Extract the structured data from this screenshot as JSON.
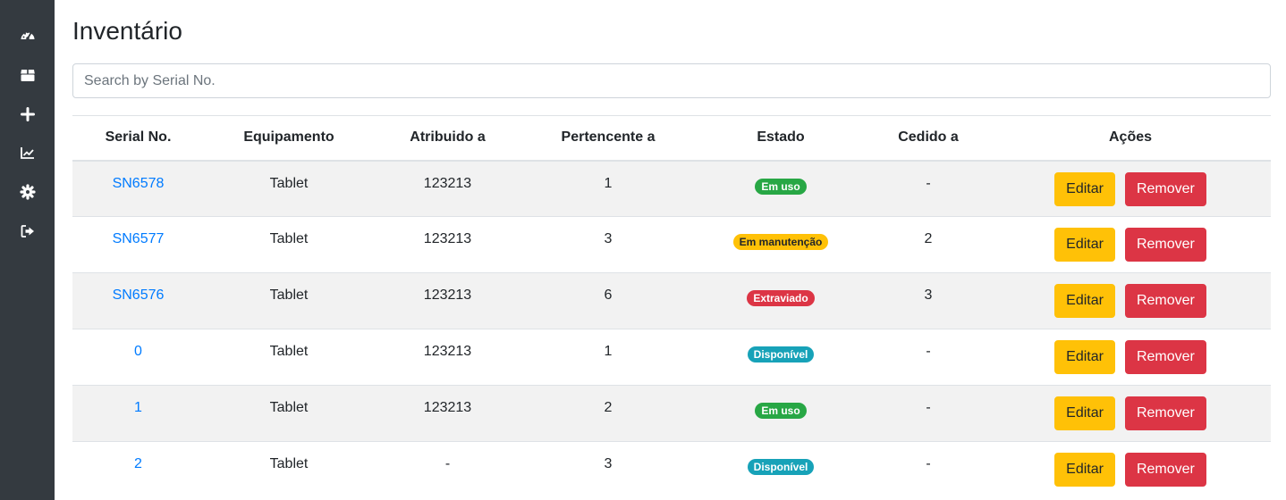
{
  "sidebar": {
    "items": [
      {
        "icon": "dashboard-icon"
      },
      {
        "icon": "box-icon"
      },
      {
        "icon": "plus-icon"
      },
      {
        "icon": "chart-line-icon"
      },
      {
        "icon": "gear-icon"
      },
      {
        "icon": "sign-out-icon"
      }
    ]
  },
  "page": {
    "title": "Inventário"
  },
  "search": {
    "placeholder": "Search by Serial No.",
    "value": ""
  },
  "table": {
    "headers": [
      "Serial No.",
      "Equipamento",
      "Atribuido a",
      "Pertencente a",
      "Estado",
      "Cedido a",
      "Ações"
    ],
    "rows": [
      {
        "serial": "SN6578",
        "equipment": "Tablet",
        "assigned": "123213",
        "belongs": "1",
        "status": "Em uso",
        "status_type": "success",
        "ceded": "-",
        "edit": "Editar",
        "remove": "Remover"
      },
      {
        "serial": "SN6577",
        "equipment": "Tablet",
        "assigned": "123213",
        "belongs": "3",
        "status": "Em manutenção",
        "status_type": "warning",
        "ceded": "2",
        "edit": "Editar",
        "remove": "Remover"
      },
      {
        "serial": "SN6576",
        "equipment": "Tablet",
        "assigned": "123213",
        "belongs": "6",
        "status": "Extraviado",
        "status_type": "danger",
        "ceded": "3",
        "edit": "Editar",
        "remove": "Remover"
      },
      {
        "serial": "0",
        "equipment": "Tablet",
        "assigned": "123213",
        "belongs": "1",
        "status": "Disponível",
        "status_type": "info",
        "ceded": "-",
        "edit": "Editar",
        "remove": "Remover"
      },
      {
        "serial": "1",
        "equipment": "Tablet",
        "assigned": "123213",
        "belongs": "2",
        "status": "Em uso",
        "status_type": "success",
        "ceded": "-",
        "edit": "Editar",
        "remove": "Remover"
      },
      {
        "serial": "2",
        "equipment": "Tablet",
        "assigned": "-",
        "belongs": "3",
        "status": "Disponível",
        "status_type": "info",
        "ceded": "-",
        "edit": "Editar",
        "remove": "Remover"
      }
    ]
  },
  "colors": {
    "sidebar_bg": "#343a40",
    "link": "#007bff",
    "edit_button": "#ffc107",
    "remove_button": "#dc3545",
    "status_success": "#28a745",
    "status_warning": "#ffc107",
    "status_danger": "#dc3545",
    "status_info": "#17a2b8"
  }
}
